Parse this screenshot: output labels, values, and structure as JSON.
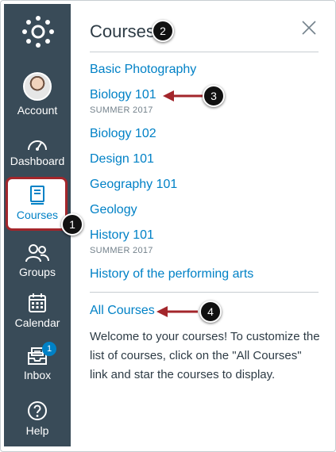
{
  "nav": {
    "account": "Account",
    "dashboard": "Dashboard",
    "courses": "Courses",
    "groups": "Groups",
    "calendar": "Calendar",
    "inbox": "Inbox",
    "inbox_badge": "1",
    "help": "Help"
  },
  "tray": {
    "title": "Courses",
    "courses": [
      {
        "name": "Basic Photography",
        "term": ""
      },
      {
        "name": "Biology 101",
        "term": "SUMMER 2017"
      },
      {
        "name": "Biology 102",
        "term": ""
      },
      {
        "name": "Design 101",
        "term": ""
      },
      {
        "name": "Geography 101",
        "term": ""
      },
      {
        "name": "Geology",
        "term": ""
      },
      {
        "name": "History 101",
        "term": "SUMMER 2017"
      },
      {
        "name": "History of the performing arts",
        "term": ""
      }
    ],
    "all_courses": "All Courses",
    "welcome": "Welcome to your courses! To customize the list of courses, click on the \"All Courses\" link and star the courses to display."
  },
  "callouts": [
    "1",
    "2",
    "3",
    "4"
  ],
  "colors": {
    "sidebar": "#394b58",
    "link": "#0081c6",
    "highlight": "#a3262b",
    "callout": "#111111"
  },
  "icons": [
    "canvas-logo-icon",
    "dashboard-icon",
    "courses-icon",
    "groups-icon",
    "calendar-icon",
    "inbox-icon",
    "help-icon",
    "close-icon",
    "arrow-icon"
  ]
}
